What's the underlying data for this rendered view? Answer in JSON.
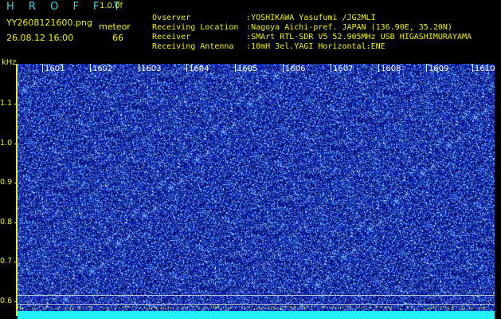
{
  "header": {
    "title": "H R O F F T",
    "version": "1.0.0f",
    "filename": "YY2608121600.png",
    "datetime": "26.08.12 16:00",
    "meteor_label": "meteor",
    "meteor_count": "66"
  },
  "info": [
    {
      "label": "Ovserver",
      "value": ":YOSHIKAWA Yasufumi /JG2MLI"
    },
    {
      "label": "Receiving Location",
      "value": ":Nagoya Aichi-pref. JAPAN (136.90E, 35.20N)"
    },
    {
      "label": "Receiver",
      "value": ":SMArt RTL-SDR V5 52.905MHz USB HIGASHIMURAYAMA"
    },
    {
      "label": "Receiving Antenna",
      "value": ":10mH 3el.YAGI Horizontal:ENE"
    }
  ],
  "axis": {
    "y_unit": "kHz",
    "y_ticks": [
      "1.1",
      "1.0",
      "0.9",
      "0.8",
      "0.7",
      "0.6"
    ],
    "x_ticks": [
      "1601",
      "1602",
      "1603",
      "1604",
      "1605",
      "1606",
      "1607",
      "1608",
      "1609",
      "1610"
    ]
  },
  "colors": {
    "background": "#000000",
    "plot_blue": "#0b1aa6",
    "text_yellow": "#f0f000",
    "title_cyan": "#3cd7e6",
    "noise_light": "#6fd4ff",
    "bottom_band": "#22f0f8"
  }
}
